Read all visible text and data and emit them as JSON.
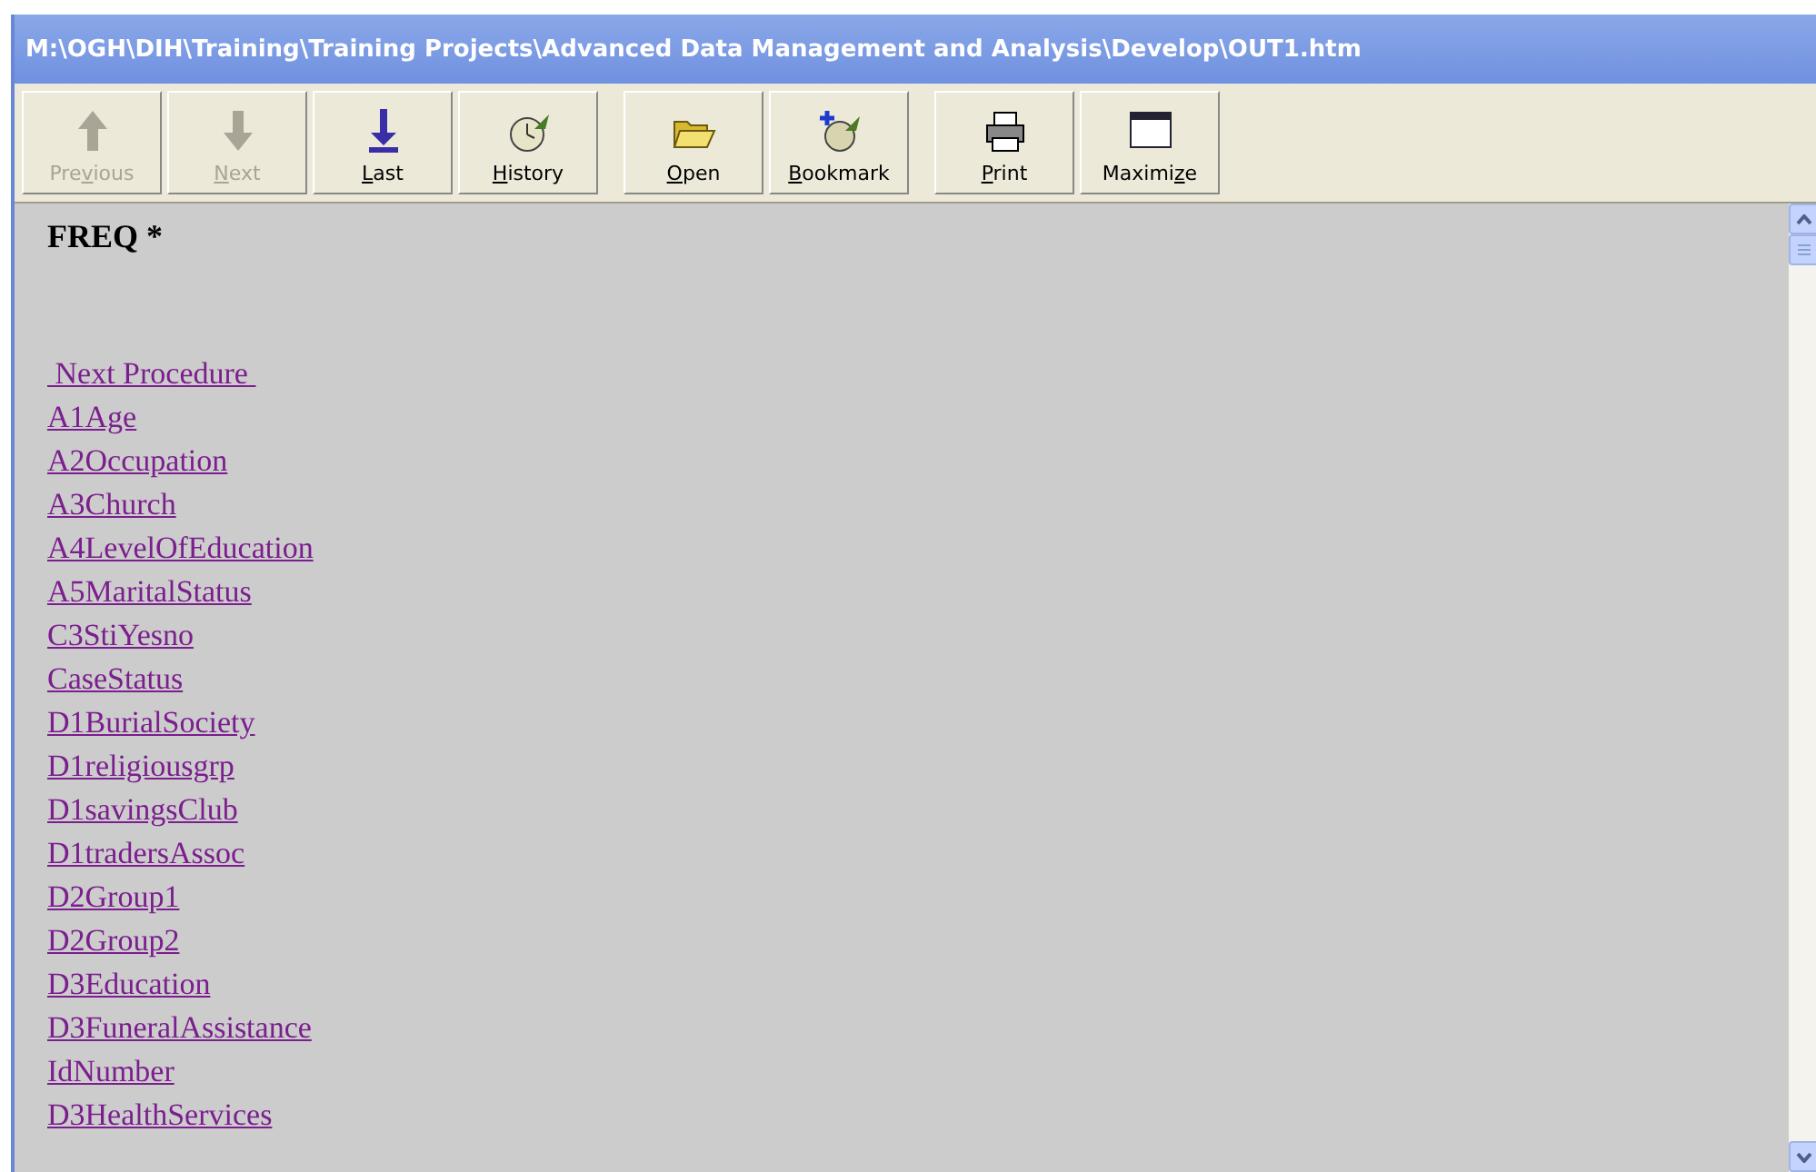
{
  "window": {
    "title": "M:\\OGH\\DIH\\Training\\Training Projects\\Advanced Data Management and Analysis\\Develop\\OUT1.htm"
  },
  "toolbar": [
    {
      "kind": "up",
      "label_before": "Pre",
      "access_key": "v",
      "label_after": "ious",
      "disabled": true
    },
    {
      "kind": "down",
      "access_key": "N",
      "label_after": "ext",
      "disabled": true
    },
    {
      "kind": "last",
      "access_key": "L",
      "label_after": "ast",
      "disabled": false
    },
    {
      "kind": "history",
      "access_key": "H",
      "label_after": "istory",
      "disabled": false
    },
    {
      "kind": "open",
      "access_key": "O",
      "label_after": "pen",
      "disabled": false
    },
    {
      "kind": "bookmark",
      "access_key": "B",
      "label_after": "ookmark",
      "disabled": false
    },
    {
      "kind": "print",
      "access_key": "P",
      "label_after": "rint",
      "disabled": false
    },
    {
      "kind": "maximize",
      "label_before": "Maximi",
      "access_key": "z",
      "label_after": "e",
      "disabled": false
    }
  ],
  "content": {
    "heading": "FREQ *",
    "links": [
      " Next Procedure ",
      "A1Age",
      "A2Occupation",
      "A3Church",
      "A4LevelOfEducation",
      "A5MaritalStatus",
      "C3StiYesno",
      "CaseStatus",
      "D1BurialSociety",
      "D1religiousgrp",
      "D1savingsClub",
      "D1tradersAssoc",
      "D2Group1",
      "D2Group2",
      "D3Education",
      "D3FuneralAssistance",
      "IdNumber",
      "D3HealthServices"
    ]
  }
}
